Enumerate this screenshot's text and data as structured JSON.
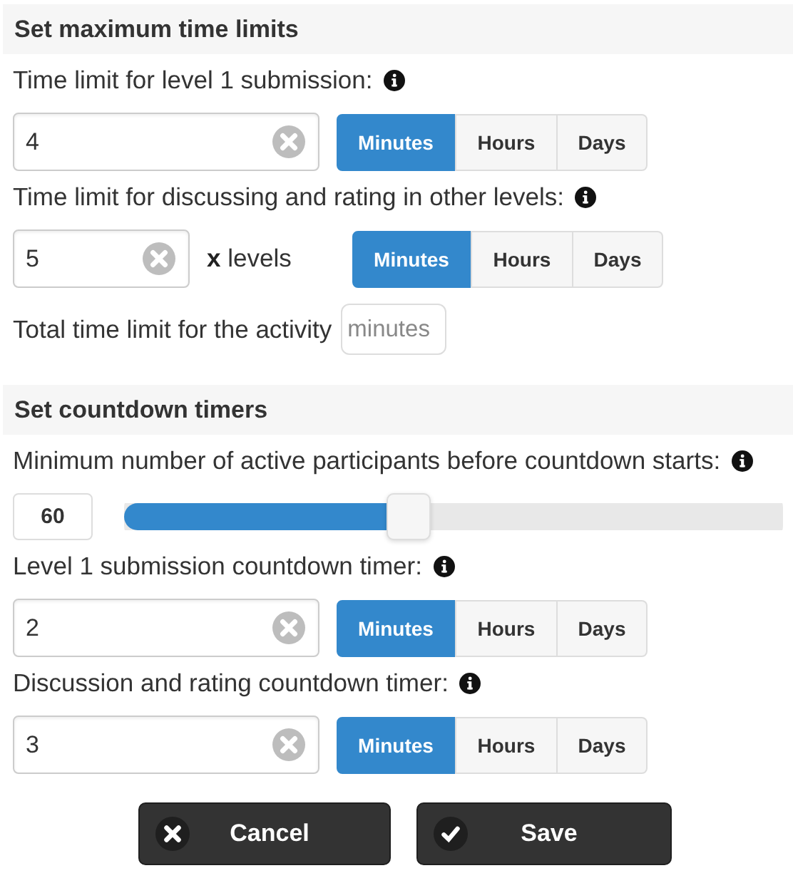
{
  "sections": [
    {
      "title": "Set maximum time limits",
      "items": [
        {
          "kind": "duration",
          "label": "Time limit for level 1 submission:",
          "info": true,
          "value": "4",
          "units": [
            {
              "label": "Minutes",
              "selected": true
            },
            {
              "label": "Hours",
              "selected": false
            },
            {
              "label": "Days",
              "selected": false
            }
          ]
        },
        {
          "kind": "duration",
          "label": "Time limit for discussing and rating in other levels:",
          "info": true,
          "value": "5",
          "multiplier": "**x** levels",
          "units": [
            {
              "label": "Minutes",
              "selected": true
            },
            {
              "label": "Hours",
              "selected": false
            },
            {
              "label": "Days",
              "selected": false
            }
          ]
        },
        {
          "kind": "total",
          "label": "Total time limit for the activity",
          "placeholder": "minutes"
        }
      ]
    },
    {
      "title": "Set countdown timers",
      "items": [
        {
          "kind": "slider",
          "label": "Minimum number of active participants before countdown starts:",
          "info": true,
          "value": "60",
          "level": 0.43
        },
        {
          "kind": "duration",
          "label": "Level 1 submission countdown timer:",
          "info": true,
          "value": "2",
          "units": [
            {
              "label": "Minutes",
              "selected": true
            },
            {
              "label": "Hours",
              "selected": false
            },
            {
              "label": "Days",
              "selected": false
            }
          ]
        },
        {
          "kind": "duration",
          "label": "Discussion and rating countdown timer:",
          "info": true,
          "value": "3",
          "units": [
            {
              "label": "Minutes",
              "selected": true
            },
            {
              "label": "Hours",
              "selected": false
            },
            {
              "label": "Days",
              "selected": false
            }
          ]
        }
      ]
    }
  ],
  "buttons": [
    {
      "kind": "cancel",
      "label": "Cancel"
    },
    {
      "kind": "save",
      "label": "Save"
    }
  ]
}
